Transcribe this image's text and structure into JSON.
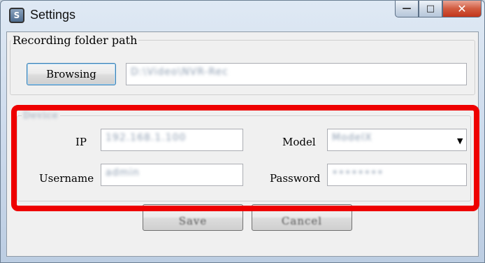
{
  "window": {
    "title": "Settings",
    "app_icon_glyph": "S",
    "icons": [
      "minimize-icon",
      "maximize-icon",
      "close-icon"
    ],
    "caption": {
      "minimize": "—",
      "maximize": "□",
      "close": "✕"
    }
  },
  "recording": {
    "legend": "Recording folder path",
    "browse_label": "Browsing",
    "path_value": "D:\\Video\\NVR-Rec"
  },
  "device": {
    "legend": "Device",
    "ip_label": "IP",
    "ip_value": "192.168.1.100",
    "model_label": "Model",
    "model_value": "ModelX",
    "username_label": "Username",
    "username_value": "admin",
    "password_label": "Password",
    "password_value": "••••••••"
  },
  "footer": {
    "save_label": "Save",
    "cancel_label": "Cancel"
  },
  "highlight_color": "#ee0000"
}
